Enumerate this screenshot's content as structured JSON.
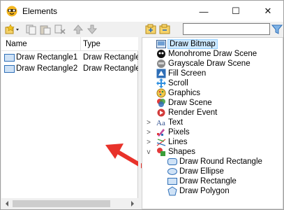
{
  "window": {
    "title": "Elements",
    "buttons": {
      "minimize": "—",
      "maximize": "☐",
      "close": "✕"
    }
  },
  "left_toolbar": {
    "icons": [
      "add-element-dropdown-icon",
      "copy-icon",
      "paste-icon",
      "delete-icon",
      "move-up-icon",
      "move-down-icon"
    ]
  },
  "element_list": {
    "columns": [
      "Name",
      "Type"
    ],
    "rows": [
      {
        "name": "Draw Rectangle1",
        "type": "Draw Rectangle"
      },
      {
        "name": "Draw Rectangle2",
        "type": "Draw Rectangle"
      }
    ]
  },
  "right_toolbar": {
    "icons": [
      "expand-all-icon",
      "collapse-all-icon",
      "filter-icon"
    ],
    "search_value": ""
  },
  "tree": {
    "items": [
      {
        "label": "Draw Bitmap",
        "icon": "bitmap-icon",
        "selected": true
      },
      {
        "label": "Monohrome Draw Scene",
        "icon": "monochrome-icon"
      },
      {
        "label": "Grayscale Draw Scene",
        "icon": "grayscale-icon"
      },
      {
        "label": "Fill Screen",
        "icon": "fill-icon"
      },
      {
        "label": "Scroll",
        "icon": "scroll-icon"
      },
      {
        "label": "Graphics",
        "icon": "graphics-icon"
      },
      {
        "label": "Draw Scene",
        "icon": "scene-icon"
      },
      {
        "label": "Render Event",
        "icon": "render-icon"
      },
      {
        "label": "Text",
        "icon": "text-icon",
        "expander": ">"
      },
      {
        "label": "Pixels",
        "icon": "pixels-icon",
        "expander": ">"
      },
      {
        "label": "Lines",
        "icon": "lines-icon",
        "expander": ">"
      },
      {
        "label": "Shapes",
        "icon": "shapes-icon",
        "expander": "v"
      },
      {
        "label": "Draw Round Rectangle",
        "icon": "round-rect-icon"
      },
      {
        "label": "Draw Ellipse",
        "icon": "ellipse-icon"
      },
      {
        "label": "Draw Rectangle",
        "icon": "rect-icon"
      },
      {
        "label": "Draw Polygon",
        "icon": "polygon-icon"
      }
    ]
  },
  "colors": {
    "selection": "#cce8ff",
    "arrow": "#e8322a",
    "accent": "#2f6fb7"
  }
}
